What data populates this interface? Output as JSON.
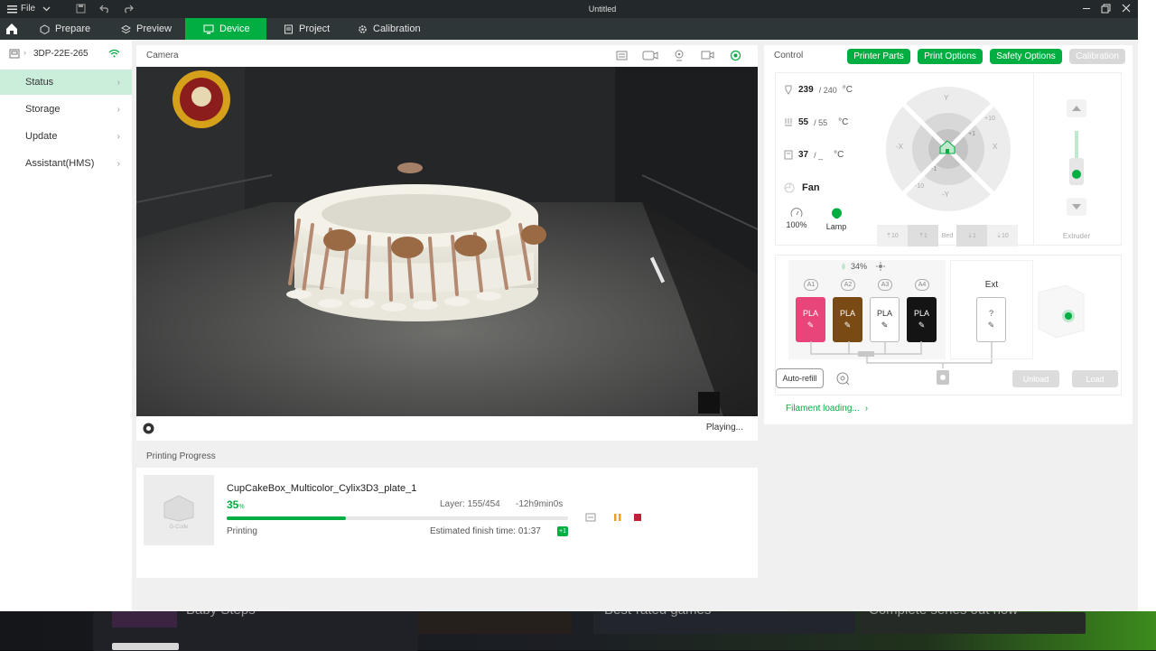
{
  "titlebar": {
    "menu_label": "File",
    "title": "Untitled"
  },
  "tabs": [
    {
      "label": "Prepare"
    },
    {
      "label": "Preview"
    },
    {
      "label": "Device"
    },
    {
      "label": "Project"
    },
    {
      "label": "Calibration"
    }
  ],
  "sidebar": {
    "device_name": "3DP-22E-265",
    "items": [
      {
        "label": "Status",
        "active": true
      },
      {
        "label": "Storage"
      },
      {
        "label": "Update"
      },
      {
        "label": "Assistant(HMS)"
      }
    ]
  },
  "camera": {
    "title": "Camera",
    "status": "Playing..."
  },
  "progress": {
    "title": "Printing Progress",
    "thumb_label": "G-Code",
    "file_name": "CupCakeBox_Multicolor_Cylix3D3_plate_1",
    "percent": "35",
    "percent_unit": "%",
    "fraction": 0.35,
    "layer": "Layer: 155/454",
    "remaining": "-12h9min0s",
    "status": "Printing",
    "eta": "Estimated finish time: 01:37",
    "eta_badge": "+1"
  },
  "control": {
    "title": "Control",
    "buttons": {
      "parts": "Printer Parts",
      "options": "Print Options",
      "safety": "Safety Options",
      "calibration": "Calibration"
    },
    "nozzle": {
      "value": "239",
      "target": "/ 240",
      "unit": "°C"
    },
    "bed": {
      "value": "55",
      "target": "/ 55",
      "unit": "°C"
    },
    "chamber": {
      "value": "37",
      "target": "/ _",
      "unit": "°C"
    },
    "fan_label": "Fan",
    "speed_label": "100%",
    "lamp_label": "Lamp",
    "jog": {
      "y": "Y",
      "neg_y": "-Y",
      "x": "X",
      "neg_x": "-X",
      "plus10": "+10",
      "plus1": "+1",
      "minus1": "-1",
      "minus10": "-10"
    },
    "bed_jog": {
      "up10": "10",
      "up1": "1",
      "label": "Bed",
      "down1": "1",
      "down10": "10"
    },
    "extruder_label": "Extruder"
  },
  "ams": {
    "humidity": "34%",
    "slot_labels": [
      "A1",
      "A2",
      "A3",
      "A4"
    ],
    "slots": [
      {
        "material": "PLA",
        "color": "#e8457a",
        "text": "#ffffff"
      },
      {
        "material": "PLA",
        "color": "#7a4a14",
        "text": "#ffffff"
      },
      {
        "material": "PLA",
        "color": "#ffffff",
        "text": "#333333"
      },
      {
        "material": "PLA",
        "color": "#141414",
        "text": "#ffffff"
      }
    ],
    "ext_title": "Ext",
    "ext_slot": "?",
    "auto_refill": "Auto-refill",
    "unload": "Unload",
    "load": "Load",
    "filament_link": "Filament loading..."
  },
  "desktop": {
    "text1": "Baby Steps",
    "text2": "Best-rated games",
    "text3": "Complete series out now"
  },
  "colors": {
    "accent": "#00ae42",
    "titlebar": "#23292a",
    "tabbar": "#2e3637",
    "active_sidebar": "#cbeedb"
  }
}
